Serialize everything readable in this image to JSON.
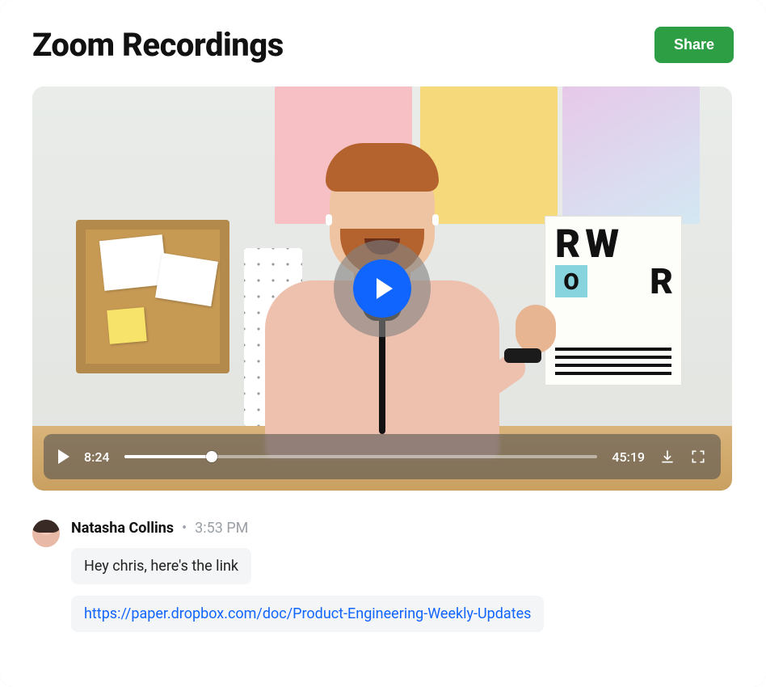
{
  "header": {
    "title": "Zoom Recordings",
    "share_label": "Share"
  },
  "video": {
    "current_time": "8:24",
    "total_time": "45:19",
    "progress_pct": 18.5
  },
  "poster": {
    "line1_left": "R",
    "line1_right": "W",
    "line2_o": "O",
    "line2_right": "R"
  },
  "comment": {
    "author": "Natasha Collins",
    "separator": "•",
    "timestamp": "3:53 PM",
    "message1": "Hey chris, here's the link",
    "link_text": "https://paper.dropbox.com/doc/Product-Engineering-Weekly-Updates"
  },
  "icons": {
    "play_small": "play-icon",
    "play_large": "play-icon",
    "download": "download-icon",
    "fullscreen": "fullscreen-icon"
  }
}
